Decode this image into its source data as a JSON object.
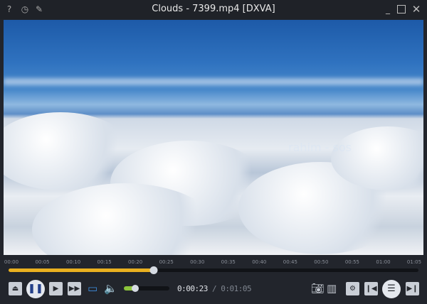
{
  "window": {
    "title": "Clouds - 7399.mp4 [DXVA]",
    "left_icons": [
      "help-icon",
      "history-icon",
      "pin-icon"
    ],
    "controls": [
      "minimize",
      "maximize",
      "close"
    ]
  },
  "video": {
    "watermark": "rahim - sos"
  },
  "timeline": {
    "ticks": [
      "00:00",
      "00:05",
      "00:10",
      "00:15",
      "00:20",
      "00:25",
      "00:30",
      "00:35",
      "00:40",
      "00:45",
      "00:50",
      "00:55",
      "01:00",
      "01:05"
    ],
    "progress_fraction": 0.354,
    "fill_color": "#e9b020"
  },
  "playback": {
    "current": "0:00:23",
    "separator": "/",
    "total": "0:01:05",
    "state": "playing"
  },
  "volume": {
    "level_fraction": 0.25,
    "color": "#8cc43c"
  }
}
